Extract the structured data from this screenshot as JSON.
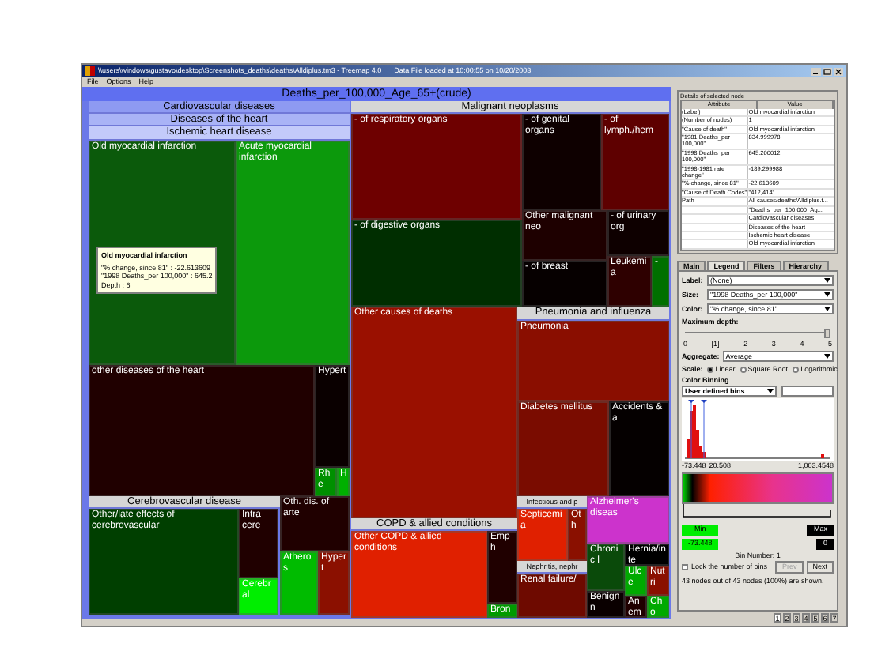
{
  "window": {
    "title": "\\\\users\\windows\\gustavo\\desktop\\Screenshots_deaths\\deaths\\Alldiplus.tm3 - Treemap 4.0",
    "status": "Data File loaded at 10:00:55 on 10/20/2003"
  },
  "menu": [
    "File",
    "Options",
    "Help"
  ],
  "treemap": {
    "title": "Deaths_per_100,000_Age_65+(crude)",
    "children": [
      {
        "kind": "group",
        "label": "Cardiovascular diseases",
        "highlighted": true,
        "children": [
          {
            "kind": "group",
            "label": "Diseases of the heart",
            "highlighted": true,
            "children": [
              {
                "kind": "group",
                "label": "Ischemic heart disease",
                "highlighted": true,
                "children": [
                  {
                    "kind": "leaf",
                    "label": "Old myocardial infarction",
                    "color": "#0b5a0b"
                  },
                  {
                    "kind": "leaf",
                    "label": "Acute myocardial infarction",
                    "color": "#0c990c"
                  }
                ]
              },
              {
                "kind": "leaf",
                "label": "other diseases of the heart",
                "color": "#200000"
              },
              {
                "kind": "leaf",
                "label": "Hypert",
                "color": "#0a0000"
              },
              {
                "kind": "leaf",
                "label": "Rhe",
                "color": "#009000"
              },
              {
                "kind": "leaf",
                "label": "H",
                "color": "#00b000"
              }
            ]
          },
          {
            "kind": "group",
            "label": "Cerebrovascular disease",
            "highlighted": false,
            "children": [
              {
                "kind": "leaf",
                "label": "Other/late effects of cerebrovascular",
                "color": "#003f00"
              },
              {
                "kind": "leaf",
                "label": "Intra cere",
                "color": "#200000"
              },
              {
                "kind": "leaf",
                "label": "Cerebral",
                "color": "#00ee00"
              }
            ]
          },
          {
            "kind": "leaf",
            "label": "Oth. dis. of arte",
            "color": "#200000"
          },
          {
            "kind": "leaf",
            "label": "Atheros",
            "color": "#00bb00"
          },
          {
            "kind": "leaf",
            "label": "Hypert",
            "color": "#8b1000"
          }
        ]
      },
      {
        "kind": "group",
        "label": "Malignant neoplasms",
        "highlighted": false,
        "children": [
          {
            "kind": "leaf",
            "label": "- of respiratory organs",
            "color": "#6e0000"
          },
          {
            "kind": "leaf",
            "label": "- of digestive organs",
            "color": "#002e00"
          },
          {
            "kind": "leaf",
            "label": "- of genital organs",
            "color": "#0e0000"
          },
          {
            "kind": "leaf",
            "label": "- of lymph./hem",
            "color": "#5e0000"
          },
          {
            "kind": "leaf",
            "label": "Other malignant neo",
            "color": "#1e0000"
          },
          {
            "kind": "leaf",
            "label": "- of urinary org",
            "color": "#0e0000"
          },
          {
            "kind": "leaf",
            "label": "- of breast",
            "color": "#060000"
          },
          {
            "kind": "leaf",
            "label": "Leukemia",
            "color": "#2e0000"
          },
          {
            "kind": "leaf",
            "label": "-",
            "color": "#007000"
          }
        ]
      },
      {
        "kind": "leaf",
        "label": "Other causes of deaths",
        "color": "#9a1000"
      },
      {
        "kind": "group",
        "label": "COPD & allied conditions",
        "highlighted": false,
        "children": [
          {
            "kind": "leaf",
            "label": "Other COPD & allied conditions",
            "color": "#e02000"
          },
          {
            "kind": "leaf",
            "label": "Emph",
            "color": "#200000"
          },
          {
            "kind": "leaf",
            "label": "Bron",
            "color": "#009a00"
          }
        ]
      },
      {
        "kind": "group",
        "label": "Pneumonia and influenza",
        "highlighted": false,
        "children": [
          {
            "kind": "leaf",
            "label": "Pneumonia",
            "color": "#8a0e00"
          }
        ]
      },
      {
        "kind": "leaf",
        "label": "Diabetes mellitus",
        "color": "#7a0c00"
      },
      {
        "kind": "leaf",
        "label": "Accidents & a",
        "color": "#050000"
      },
      {
        "kind": "group",
        "label": "Infectious and p",
        "highlighted": false,
        "children": [
          {
            "kind": "leaf",
            "label": "Septicemia",
            "color": "#e02000"
          },
          {
            "kind": "leaf",
            "label": "Oth",
            "color": "#8a1000"
          }
        ]
      },
      {
        "kind": "group",
        "label": "Nephritis, nephr",
        "highlighted": false,
        "children": [
          {
            "kind": "leaf",
            "label": "Renal failure/",
            "color": "#6e0a00"
          }
        ]
      },
      {
        "kind": "leaf",
        "label": "Alzheimer's diseas",
        "color": "#cc33cc"
      },
      {
        "kind": "leaf",
        "label": "Chronic l",
        "color": "#0a4a0a"
      },
      {
        "kind": "leaf",
        "label": "Benign n",
        "color": "#0a0000"
      },
      {
        "kind": "leaf",
        "label": "Hernia/inte",
        "color": "#000000"
      },
      {
        "kind": "leaf",
        "label": "Ulce",
        "color": "#00aa00"
      },
      {
        "kind": "leaf",
        "label": "Nutri",
        "color": "#8a1000"
      },
      {
        "kind": "leaf",
        "label": "Anem",
        "color": "#200000"
      },
      {
        "kind": "leaf",
        "label": "Cho",
        "color": "#00aa00"
      }
    ]
  },
  "tooltip": {
    "title": "Old myocardial infarction",
    "lines": [
      "\"% change, since 81\" : -22.613609",
      "\"1998 Deaths_per 100,000\" : 645.2",
      "Depth : 6"
    ]
  },
  "details": {
    "title": "Details of selected node",
    "columns": [
      "Attribute",
      "Value"
    ],
    "rows": [
      {
        "attribute": "(Label)",
        "value": "Old myocardial infarction"
      },
      {
        "attribute": "(Number of nodes)",
        "value": "1"
      },
      {
        "attribute": "\"Cause of death\"",
        "value": "Old myocardial infarction"
      },
      {
        "attribute": "\"1981 Deaths_per 100,000\"",
        "value": "834.999978"
      },
      {
        "attribute": "\"1998 Deaths_per 100,000\"",
        "value": "645.200012"
      },
      {
        "attribute": "\"1998-1981 rate change\"",
        "value": "-189.299988"
      },
      {
        "attribute": "\"% change, since 81\"",
        "value": "-22.613609"
      },
      {
        "attribute": "\"Cause of Death Codes\"",
        "value": "\"412,414\""
      },
      {
        "attribute": "Path",
        "value": "All causes/deaths/Alldiplus.t..."
      },
      {
        "value": "\"Deaths_per_100,000_Ag..."
      },
      {
        "value": "Cardiovascular diseases"
      },
      {
        "value": "Diseases of the heart"
      },
      {
        "value": "Ischemic heart disease"
      },
      {
        "value": "Old myocardial infarction"
      }
    ]
  },
  "tabs": [
    {
      "label": "Main",
      "selected": false
    },
    {
      "label": "Legend",
      "selected": true
    },
    {
      "label": "Filters",
      "selected": false
    },
    {
      "label": "Hierarchy",
      "selected": false
    }
  ],
  "legend": {
    "selects": [
      {
        "label": "Label:",
        "value": "(None)"
      },
      {
        "label": "Size:",
        "value": "\"1998 Deaths_per 100,000\""
      },
      {
        "label": "Color:",
        "value": "\"% change, since 81\""
      }
    ],
    "depth_label": "Maximum depth:",
    "depth_slider": {
      "level": 1
    },
    "depth_ticks": [
      "0",
      "[1]",
      "2",
      "3",
      "4",
      "5"
    ],
    "aggregate": {
      "label": "Aggregate:",
      "value": "Average"
    },
    "scale": {
      "label": "Scale:",
      "options": [
        {
          "label": "Linear",
          "selected": true
        },
        {
          "label": "Square Root",
          "selected": false
        },
        {
          "label": "Logarithmic",
          "selected": false
        }
      ]
    },
    "binning_label": "Color Binning",
    "bins_select": "User defined bins",
    "axis": [
      "-73.448",
      "20.508",
      "1,003.4548"
    ],
    "min": {
      "label": "Min",
      "value": "-73.448"
    },
    "max": {
      "label": "Max",
      "value": "0"
    },
    "bin_number": "Bin Number: 1",
    "lock": {
      "label": "Lock the number of bins",
      "checked": false
    },
    "prev": {
      "label": "Prev",
      "disabled": true
    },
    "next": {
      "label": "Next",
      "disabled": false
    },
    "summary": "43 nodes out of 43 nodes (100%) are shown."
  },
  "pages": [
    {
      "label": "1",
      "selected": true
    },
    {
      "label": "2",
      "selected": false
    },
    {
      "label": "3",
      "selected": false
    },
    {
      "label": "4",
      "selected": false
    },
    {
      "label": "5",
      "selected": false
    },
    {
      "label": "6",
      "selected": false
    },
    {
      "label": "7",
      "selected": false
    }
  ]
}
